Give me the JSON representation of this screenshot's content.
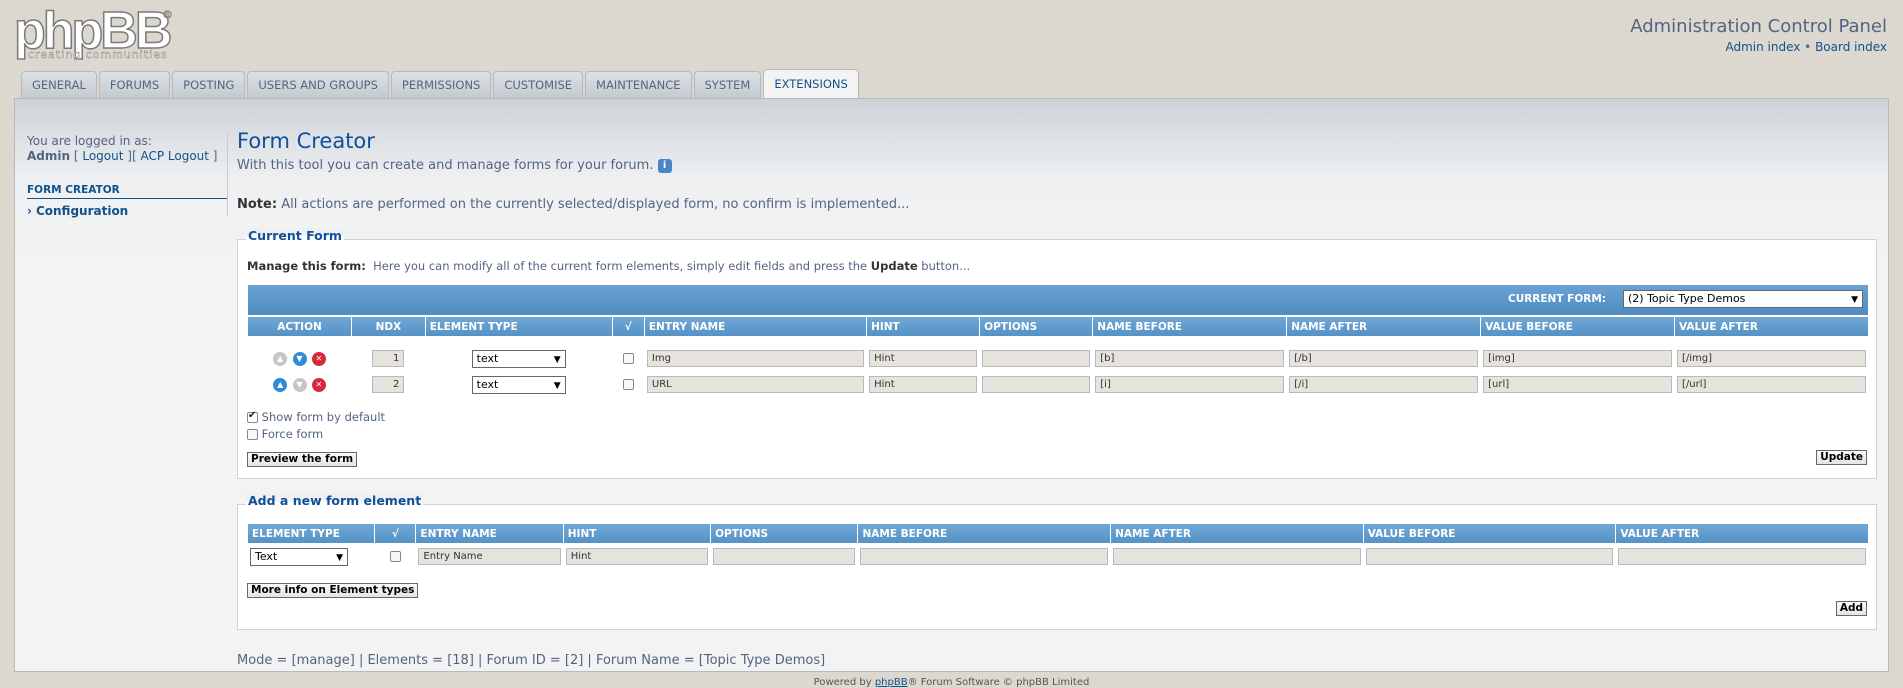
{
  "header": {
    "logo_text": "phpBB",
    "logo_reg": "®",
    "logo_tagline": "creating communities",
    "title": "Administration Control Panel",
    "link_admin": "Admin index",
    "link_sep": "•",
    "link_board": "Board index"
  },
  "tabs": [
    "GENERAL",
    "FORUMS",
    "POSTING",
    "USERS AND GROUPS",
    "PERMISSIONS",
    "CUSTOMISE",
    "MAINTENANCE",
    "SYSTEM",
    "EXTENSIONS"
  ],
  "active_tab": "EXTENSIONS",
  "sidebar": {
    "logged_in_as": "You are logged in as:",
    "user": "Admin",
    "logout": "Logout",
    "acp_logout": "ACP Logout",
    "section": "FORM CREATOR",
    "item": "Configuration"
  },
  "main": {
    "title": "Form Creator",
    "intro": "With this tool you can create and manage forms for your forum.",
    "info_icon": "i",
    "note_label": "Note:",
    "note_text": "All actions are performed on the currently selected/displayed form, no confirm is implemented..."
  },
  "current_form": {
    "legend": "Current Form",
    "manage_label": "Manage this form:",
    "manage_text_a": "Here you can modify all of the current form elements, simply edit fields and press the",
    "manage_text_b": "Update",
    "manage_text_c": "button...",
    "current_form_label": "CURRENT FORM:",
    "current_form_value": "(2) Topic Type Demos",
    "columns": [
      "ACTION",
      "NDX",
      "ELEMENT TYPE",
      "√",
      "ENTRY NAME",
      "HINT",
      "OPTIONS",
      "NAME BEFORE",
      "NAME AFTER",
      "VALUE BEFORE",
      "VALUE AFTER"
    ],
    "rows": [
      {
        "ndx": "1",
        "type": "text",
        "entry_name": "Img",
        "hint": "Hint",
        "options": "",
        "name_before": "[b]",
        "name_after": "[/b]",
        "value_before": "[img]",
        "value_after": "[/img]"
      },
      {
        "ndx": "2",
        "type": "text",
        "entry_name": "URL",
        "hint": "Hint",
        "options": "",
        "name_before": "[i]",
        "name_after": "[/i]",
        "value_before": "[url]",
        "value_after": "[/url]"
      }
    ],
    "show_default_label": "Show form by default",
    "force_form_label": "Force form",
    "preview_button": "Preview the form",
    "update_button": "Update"
  },
  "add_element": {
    "legend": "Add a new form element",
    "columns": [
      "ELEMENT TYPE",
      "√",
      "ENTRY NAME",
      "HINT",
      "OPTIONS",
      "NAME BEFORE",
      "NAME AFTER",
      "VALUE BEFORE",
      "VALUE AFTER"
    ],
    "row": {
      "type": "Text",
      "entry_name": "Entry Name",
      "hint": "Hint"
    },
    "more_info_button": "More info on Element types",
    "add_button": "Add"
  },
  "status_line": "Mode = [manage] | Elements = [18] | Forum ID = [2] | Forum Name = [Topic Type Demos]",
  "footer": {
    "prefix": "Powered by",
    "link": "phpBB",
    "suffix": "® Forum Software © phpBB Limited"
  }
}
